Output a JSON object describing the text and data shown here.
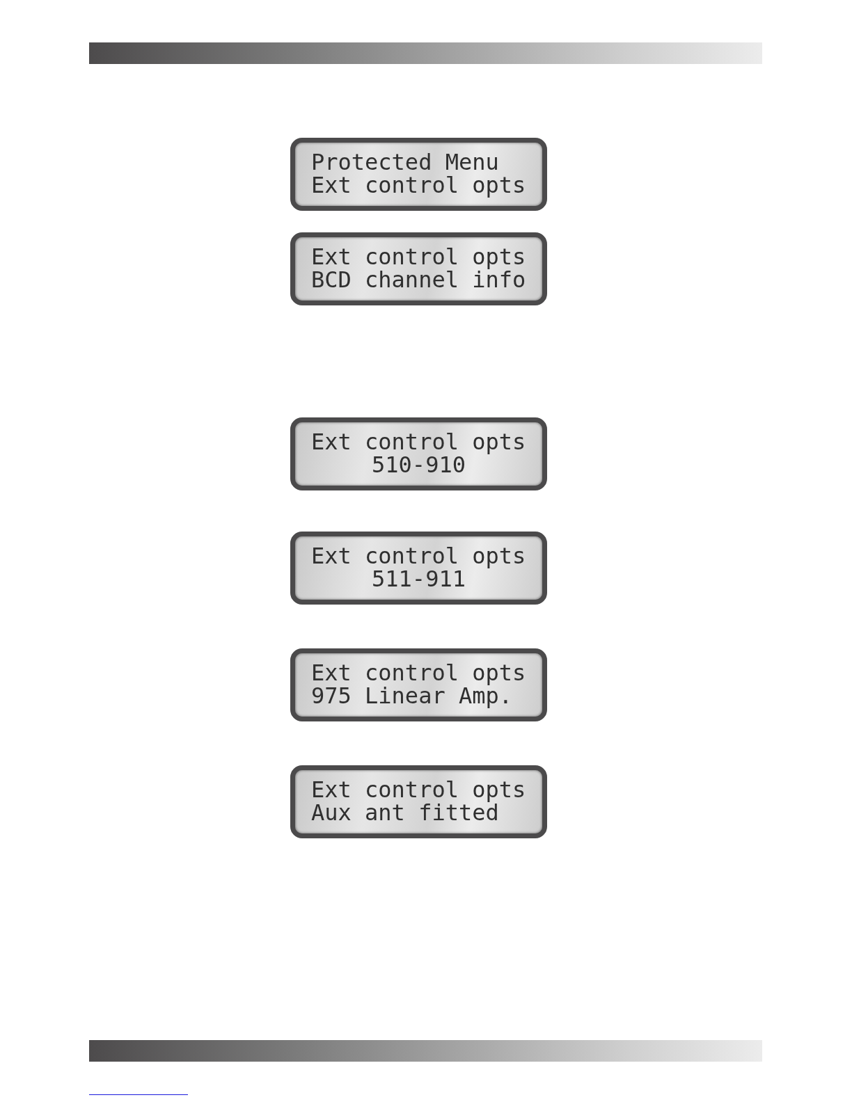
{
  "displays": [
    {
      "lines": [
        {
          "text": "Protected Menu",
          "centered": false
        },
        {
          "text": "Ext control opts",
          "centered": false
        }
      ]
    },
    {
      "lines": [
        {
          "text": "Ext control opts",
          "centered": false
        },
        {
          "text": "BCD channel info",
          "centered": false
        }
      ]
    },
    {
      "lines": [
        {
          "text": "Ext control opts",
          "centered": false
        },
        {
          "text": "510-910",
          "centered": true
        }
      ]
    },
    {
      "lines": [
        {
          "text": "Ext control opts",
          "centered": false
        },
        {
          "text": "511-911",
          "centered": true
        }
      ]
    },
    {
      "lines": [
        {
          "text": "Ext control opts",
          "centered": false
        },
        {
          "text": "975 Linear Amp.",
          "centered": false
        }
      ]
    },
    {
      "lines": [
        {
          "text": "Ext control opts",
          "centered": false
        },
        {
          "text": "Aux ant fitted",
          "centered": false
        }
      ]
    }
  ]
}
